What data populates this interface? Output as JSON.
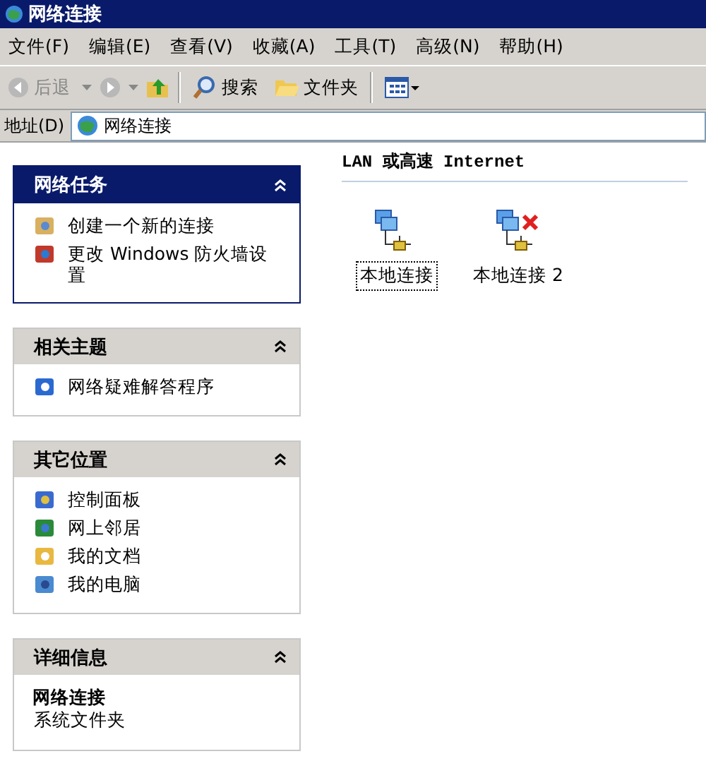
{
  "window": {
    "title": "网络连接"
  },
  "menu": [
    "文件(F)",
    "编辑(E)",
    "查看(V)",
    "收藏(A)",
    "工具(T)",
    "高级(N)",
    "帮助(H)"
  ],
  "toolbar": {
    "back": {
      "label": "后退",
      "disabled": true
    },
    "forward": {
      "disabled": true
    },
    "search": "搜索",
    "folders": "文件夹"
  },
  "address": {
    "label": "地址(D)",
    "value": "网络连接"
  },
  "panels": [
    {
      "title": "网络任务",
      "special": true,
      "items": [
        {
          "label": "创建一个新的连接"
        },
        {
          "label": "更改 Windows 防火墙设置"
        }
      ]
    },
    {
      "title": "相关主题",
      "special": false,
      "items": [
        {
          "label": "网络疑难解答程序"
        }
      ]
    },
    {
      "title": "其它位置",
      "special": false,
      "items": [
        {
          "label": "控制面板"
        },
        {
          "label": "网上邻居"
        },
        {
          "label": "我的文档"
        },
        {
          "label": "我的电脑"
        }
      ]
    },
    {
      "title": "详细信息",
      "special": false,
      "details": {
        "name": "网络连接",
        "type": "系统文件夹"
      }
    }
  ],
  "group": {
    "title": "LAN 或高速 Internet",
    "connections": [
      {
        "label": "本地连接",
        "selected": true,
        "disconnected": false
      },
      {
        "label": "本地连接 2",
        "selected": false,
        "disconnected": true
      }
    ]
  }
}
